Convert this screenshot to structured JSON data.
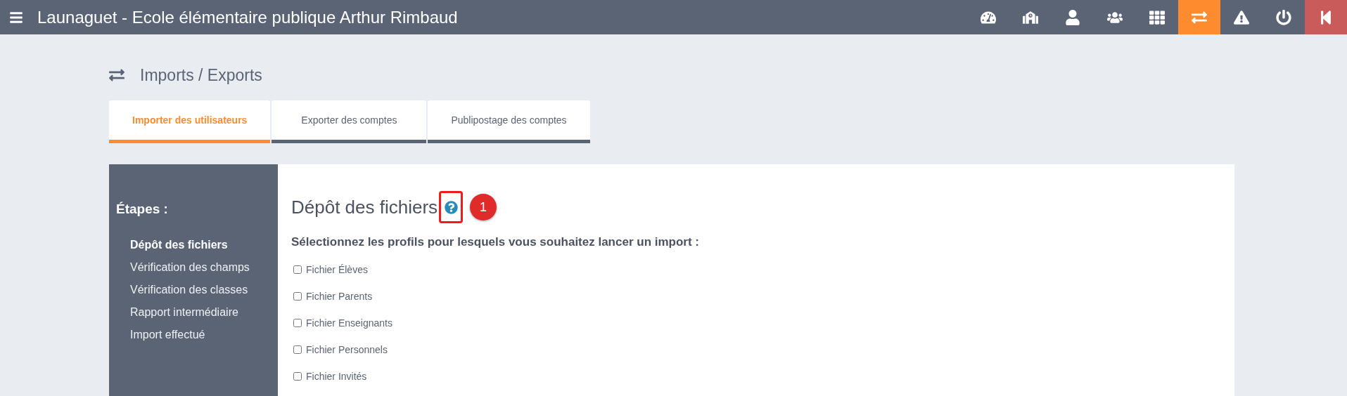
{
  "header": {
    "title": "Launaguet - Ecole élémentaire publique Arthur Rimbaud",
    "nav": [
      {
        "selected": false,
        "kind": "nav"
      },
      {
        "selected": false,
        "kind": "nav"
      },
      {
        "selected": false,
        "kind": "nav"
      },
      {
        "selected": false,
        "kind": "nav"
      },
      {
        "selected": false,
        "kind": "nav"
      },
      {
        "selected": true,
        "kind": "nav"
      },
      {
        "selected": false,
        "kind": "nav"
      },
      {
        "selected": false,
        "kind": "nav"
      },
      {
        "selected": false,
        "kind": "collapse"
      }
    ]
  },
  "page": {
    "title": "Imports / Exports"
  },
  "tabs": [
    {
      "label": "Importer des utilisateurs",
      "selected": true
    },
    {
      "label": "Exporter des comptes",
      "selected": false
    },
    {
      "label": "Publipostage des comptes",
      "selected": false
    }
  ],
  "sidebar": {
    "title": "Étapes :",
    "steps": [
      {
        "label": "Dépôt des fichiers",
        "selected": true
      },
      {
        "label": "Vérification des champs",
        "selected": false
      },
      {
        "label": "Vérification des classes",
        "selected": false
      },
      {
        "label": "Rapport intermédiaire",
        "selected": false
      },
      {
        "label": "Import effectué",
        "selected": false
      }
    ]
  },
  "content": {
    "heading": "Dépôt des fichiers",
    "callout": "1",
    "prompt": "Sélectionnez les profils pour lesquels vous souhaitez lancer un import :",
    "profiles": [
      {
        "label": "Fichier Élèves",
        "checked": false
      },
      {
        "label": "Fichier Parents",
        "checked": false
      },
      {
        "label": "Fichier Enseignants",
        "checked": false
      },
      {
        "label": "Fichier Personnels",
        "checked": false
      },
      {
        "label": "Fichier Invités",
        "checked": false
      }
    ]
  }
}
